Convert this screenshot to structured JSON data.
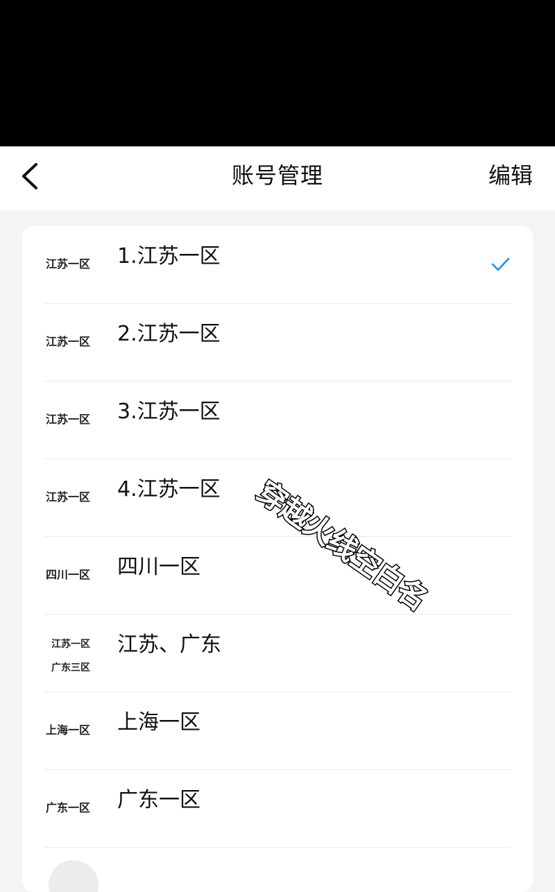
{
  "header": {
    "title": "账号管理",
    "edit_label": "编辑",
    "back_icon": "chevron-left-icon"
  },
  "accounts": [
    {
      "server_tag": "江苏一区",
      "name": "1.江苏一区",
      "selected": true
    },
    {
      "server_tag": "江苏一区",
      "name": "2.江苏一区",
      "selected": false
    },
    {
      "server_tag": "江苏一区",
      "name": "3.江苏一区",
      "selected": false
    },
    {
      "server_tag": "江苏一区",
      "name": "4.江苏一区",
      "selected": false
    },
    {
      "server_tag": "四川一区",
      "name": "四川一区",
      "selected": false
    },
    {
      "server_tag_lines": [
        "江苏一区",
        "广东三区"
      ],
      "name": "江苏、广东",
      "selected": false
    },
    {
      "server_tag": "上海一区",
      "name": "上海一区",
      "selected": false
    },
    {
      "server_tag": "广东一区",
      "name": "广东一区",
      "selected": false
    }
  ],
  "watermark": "穿越火线空白名",
  "colors": {
    "accent": "#1a90e0",
    "background": "#f4f4f4",
    "card": "#ffffff",
    "status_bar": "#000000"
  }
}
